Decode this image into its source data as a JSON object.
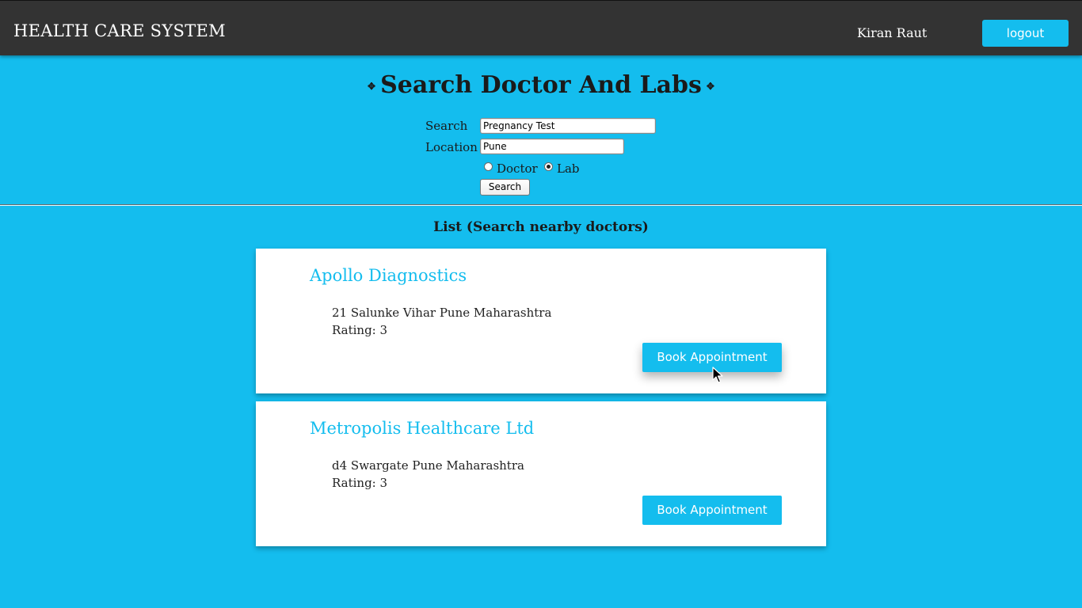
{
  "header": {
    "brand": "HEALTH CARE SYSTEM",
    "user_name": "Kiran Raut",
    "logout_label": "logout"
  },
  "search_form": {
    "title": "Search Doctor And Labs",
    "search_label": "Search",
    "search_value": "Pregnancy Test",
    "location_label": "Location",
    "location_value": "Pune",
    "type_options": [
      "Doctor",
      "Lab"
    ],
    "selected_type": "Lab",
    "submit_label": "Search"
  },
  "results": {
    "heading": "List (Search nearby doctors)",
    "items": [
      {
        "name": "Apollo Diagnostics",
        "address": "21 Salunke Vihar Pune Maharashtra",
        "rating": "Rating: 3",
        "button_label": "Book Appointment"
      },
      {
        "name": "Metropolis Healthcare Ltd",
        "address": "d4 Swargate Pune Maharashtra",
        "rating": "Rating: 3",
        "button_label": "Book Appointment"
      }
    ]
  },
  "colors": {
    "page_background": "#14bdee",
    "topbar_background": "#333333",
    "accent": "#14bdee"
  }
}
